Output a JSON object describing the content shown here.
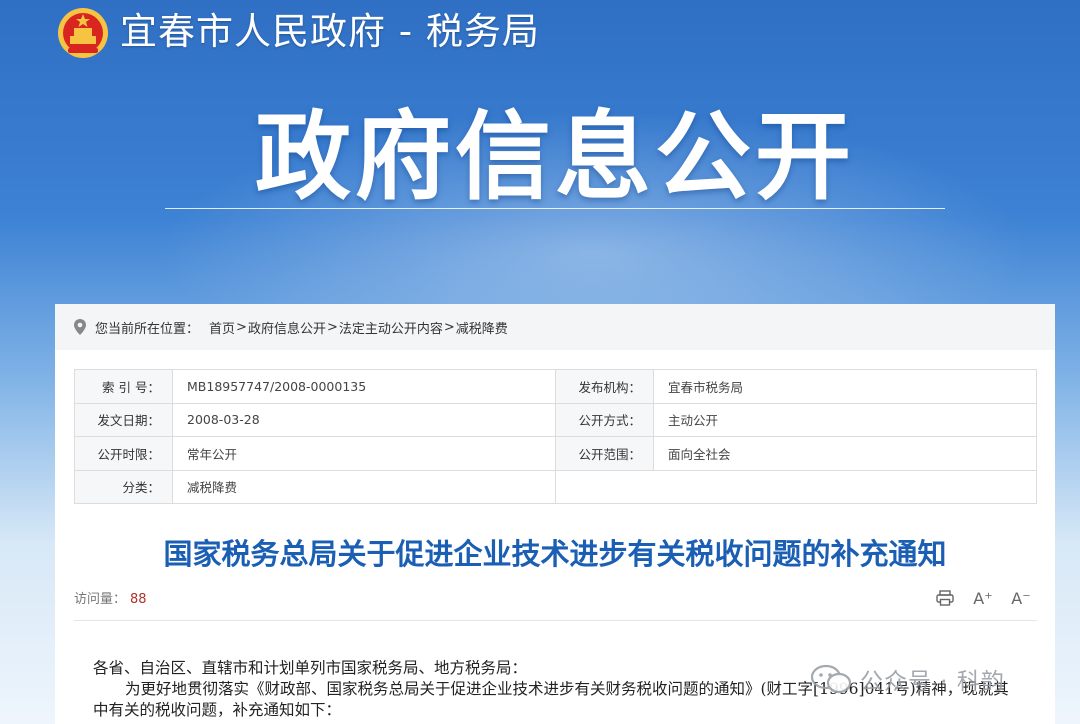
{
  "header": {
    "site_title": "宜春市人民政府 - 税务局"
  },
  "banner": {
    "title": "政府信息公开"
  },
  "breadcrumb": {
    "prefix": "您当前所在位置：",
    "items": [
      "首页",
      "政府信息公开",
      "法定主动公开内容",
      "减税降费"
    ],
    "separator": ">"
  },
  "meta": {
    "rows": [
      {
        "k1": "索 引 号：",
        "v1": "MB18957747/2008-0000135",
        "k2": "发布机构：",
        "v2": "宜春市税务局"
      },
      {
        "k1": "发文日期：",
        "v1": "2008-03-28",
        "k2": "公开方式：",
        "v2": "主动公开"
      },
      {
        "k1": "公开时限：",
        "v1": "常年公开",
        "k2": "公开范围：",
        "v2": "面向全社会"
      },
      {
        "k1": "分类：",
        "v1": "减税降费",
        "k2": "",
        "v2": ""
      }
    ]
  },
  "document": {
    "title": "国家税务总局关于促进企业技术进步有关税收问题的补充通知",
    "visits_label": "访问量：",
    "visits_count": "88",
    "font_increase": "A⁺",
    "font_decrease": "A⁻",
    "paragraphs": [
      "各省、自治区、直辖市和计划单列市国家税务局、地方税务局：",
      "为更好地贯彻落实《财政部、国家税务总局关于促进企业技术进步有关财务税收问题的通知》(财工字[1996]041号)精神，现就其中有关的税收问题，补充通知如下："
    ]
  },
  "watermark": {
    "text": "公众号 · 科韵"
  },
  "colors": {
    "title_blue": "#1a5fb4",
    "visits_red": "#b0312a"
  }
}
